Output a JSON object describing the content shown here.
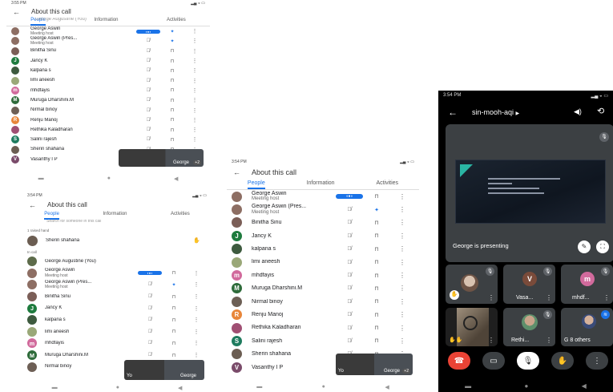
{
  "screens": {
    "p1": {
      "time": "3:55 PM",
      "title": "About this call",
      "tabs": [
        "People",
        "Information",
        "Activities"
      ],
      "top_partial": "George Augustine (You)",
      "rows": [
        {
          "name": "George Aswin",
          "sub": "Meeting host",
          "color": "#8d6e63",
          "letter": "",
          "mic": "on",
          "pin": "blue"
        },
        {
          "name": "George Aswin (Pres...",
          "sub": "Meeting host",
          "color": "#8d6e63",
          "letter": "",
          "mic": "off",
          "pin": "blue"
        },
        {
          "name": "Binitha Sinu",
          "sub": "",
          "color": "#7b5e57",
          "letter": "",
          "mic": "off",
          "pin": "grey"
        },
        {
          "name": "Jancy K",
          "sub": "",
          "color": "#1e7b3e",
          "letter": "J",
          "mic": "off",
          "pin": "grey"
        },
        {
          "name": "kalpana s",
          "sub": "",
          "color": "#3d5a3e",
          "letter": "",
          "mic": "off",
          "pin": "grey"
        },
        {
          "name": "limi aneesh",
          "sub": "",
          "color": "#9aa878",
          "letter": "",
          "mic": "off",
          "pin": "grey"
        },
        {
          "name": "mhdfayis",
          "sub": "",
          "color": "#d16a9c",
          "letter": "m",
          "mic": "off",
          "pin": "grey"
        },
        {
          "name": "Muruga Dharshini.M",
          "sub": "",
          "color": "#2e6b3a",
          "letter": "M",
          "mic": "off",
          "pin": "grey"
        },
        {
          "name": "Nirmal binoy",
          "sub": "",
          "color": "#6d5f55",
          "letter": "",
          "mic": "off",
          "pin": "grey"
        },
        {
          "name": "Renju Manoj",
          "sub": "",
          "color": "#e8863a",
          "letter": "R",
          "mic": "off",
          "pin": "grey"
        },
        {
          "name": "Rethika Kaladharan",
          "sub": "",
          "color": "#a04f73",
          "letter": "",
          "mic": "off",
          "pin": "grey"
        },
        {
          "name": "Salini rajesh",
          "sub": "",
          "color": "#1e7b5e",
          "letter": "S",
          "mic": "off",
          "pin": "grey"
        },
        {
          "name": "Sherin shahana",
          "sub": "",
          "color": "#6b5d52",
          "letter": "",
          "mic": "off",
          "pin": "grey"
        },
        {
          "name": "Vasanthy I P",
          "sub": "",
          "color": "#7a4b6a",
          "letter": "V",
          "mic": "",
          "pin": ""
        }
      ],
      "thumb_label": "George",
      "thumb_count": "+2"
    },
    "p2": {
      "time": "3:54 PM",
      "title": "About this call",
      "tabs": [
        "People",
        "Information",
        "Activities"
      ],
      "search": "Search for someone in this call",
      "raised_label": "1 raised hand",
      "raised_name": "Sherin shahana",
      "incall_label": "In call",
      "rows": [
        {
          "name": "George Augustine (You)",
          "sub": "",
          "color": "#5d6b4a",
          "letter": "",
          "mic": "",
          "pin": ""
        },
        {
          "name": "George Aswin",
          "sub": "Meeting host",
          "color": "#8d6e63",
          "letter": "",
          "mic": "on",
          "pin": "grey"
        },
        {
          "name": "George Aswin (Pres...",
          "sub": "Meeting host",
          "color": "#8d6e63",
          "letter": "",
          "mic": "off",
          "pin": "blue"
        },
        {
          "name": "Binitha Sinu",
          "sub": "",
          "color": "#7b5e57",
          "letter": "",
          "mic": "off",
          "pin": "grey"
        },
        {
          "name": "Jancy K",
          "sub": "",
          "color": "#1e7b3e",
          "letter": "J",
          "mic": "off",
          "pin": "grey"
        },
        {
          "name": "kalpana s",
          "sub": "",
          "color": "#3d5a3e",
          "letter": "",
          "mic": "off",
          "pin": "grey"
        },
        {
          "name": "limi aneesh",
          "sub": "",
          "color": "#9aa878",
          "letter": "",
          "mic": "off",
          "pin": "grey"
        },
        {
          "name": "mhdfayis",
          "sub": "",
          "color": "#d16a9c",
          "letter": "m",
          "mic": "off",
          "pin": "grey"
        },
        {
          "name": "Muruga Dharshini.M",
          "sub": "",
          "color": "#2e6b3a",
          "letter": "M",
          "mic": "off",
          "pin": "grey"
        },
        {
          "name": "Nirmal binoy",
          "sub": "",
          "color": "#6d5f55",
          "letter": "",
          "mic": "",
          "pin": ""
        }
      ],
      "thumb_label": "George",
      "thumb_left": "Yo"
    },
    "p3": {
      "time": "3:54 PM",
      "title": "About this call",
      "tabs": [
        "People",
        "Information",
        "Activities"
      ],
      "rows": [
        {
          "name": "George Aswin",
          "sub": "Meeting host",
          "color": "#8d6e63",
          "letter": "",
          "mic": "on",
          "pin": "grey"
        },
        {
          "name": "George Aswin (Pres...",
          "sub": "Meeting host",
          "color": "#8d6e63",
          "letter": "",
          "mic": "off",
          "pin": "blue"
        },
        {
          "name": "Binitha Sinu",
          "sub": "",
          "color": "#7b5e57",
          "letter": "",
          "mic": "off",
          "pin": "grey"
        },
        {
          "name": "Jancy K",
          "sub": "",
          "color": "#1e7b3e",
          "letter": "J",
          "mic": "off",
          "pin": "grey"
        },
        {
          "name": "kalpana s",
          "sub": "",
          "color": "#3d5a3e",
          "letter": "",
          "mic": "off",
          "pin": "grey"
        },
        {
          "name": "limi aneesh",
          "sub": "",
          "color": "#9aa878",
          "letter": "",
          "mic": "off",
          "pin": "grey"
        },
        {
          "name": "mhdfayis",
          "sub": "",
          "color": "#d16a9c",
          "letter": "m",
          "mic": "off",
          "pin": "grey"
        },
        {
          "name": "Muruga Dharshini.M",
          "sub": "",
          "color": "#2e6b3a",
          "letter": "M",
          "mic": "off",
          "pin": "grey"
        },
        {
          "name": "Nirmal binoy",
          "sub": "",
          "color": "#6d5f55",
          "letter": "",
          "mic": "off",
          "pin": "grey"
        },
        {
          "name": "Renju Manoj",
          "sub": "",
          "color": "#e8863a",
          "letter": "R",
          "mic": "off",
          "pin": "grey"
        },
        {
          "name": "Rethika Kaladharan",
          "sub": "",
          "color": "#a04f73",
          "letter": "",
          "mic": "off",
          "pin": "grey"
        },
        {
          "name": "Salini rajesh",
          "sub": "",
          "color": "#1e7b5e",
          "letter": "S",
          "mic": "off",
          "pin": "grey"
        },
        {
          "name": "Sherin shahana",
          "sub": "",
          "color": "#6b5d52",
          "letter": "",
          "mic": "off",
          "pin": "grey"
        },
        {
          "name": "Vasanthy I P",
          "sub": "",
          "color": "#7a4b6a",
          "letter": "V",
          "mic": "off",
          "pin": "grey"
        }
      ],
      "thumb_label": "George",
      "thumb_left": "Yo",
      "thumb_count": "+2"
    },
    "p4": {
      "time": "3:54 PM",
      "meeting_code": "sin-mooh-aqi",
      "presenting": "George is presenting",
      "tiles": [
        {
          "label": "",
          "letter": "",
          "color": "#3c4043"
        },
        {
          "label": "Vasa...",
          "letter": "V",
          "color": "#7a4b3a"
        },
        {
          "label": "mhdf...",
          "letter": "m",
          "color": "#d16a9c"
        },
        {
          "label": "",
          "letter": "",
          "color": "#222"
        },
        {
          "label": "Rethi...",
          "letter": "",
          "color": "#3c4043"
        },
        {
          "label": "G",
          "letter": "",
          "color": "#3c4043"
        }
      ],
      "others": "8 others"
    }
  }
}
